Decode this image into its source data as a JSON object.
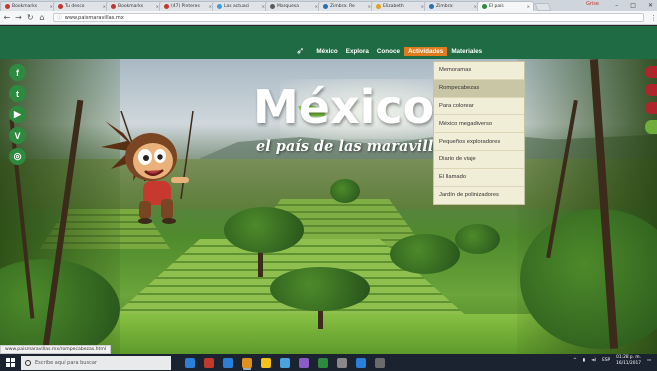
{
  "browser": {
    "tabs": [
      {
        "label": "Bookmarks",
        "color": "#c0392b"
      },
      {
        "label": "Tu desco",
        "color": "#c0392b"
      },
      {
        "label": "Bookmarks",
        "color": "#c0392b"
      },
      {
        "label": "(47) Pinteres",
        "color": "#c0392b"
      },
      {
        "label": "Las actuaci",
        "color": "#3aa0d8"
      },
      {
        "label": "Marquesa",
        "color": "#5b5b5b"
      },
      {
        "label": "Zimbra: Re",
        "color": "#2c6fb0"
      },
      {
        "label": "Elizabeth",
        "color": "#e0a020"
      },
      {
        "label": "Zimbra:",
        "color": "#2c6fb0"
      },
      {
        "label": "El país",
        "color": "#2e8a3e"
      }
    ],
    "profile": "Grise",
    "window_controls": [
      "–",
      "□",
      "✕"
    ],
    "url": "www.paismaravillas.mx"
  },
  "site": {
    "nav": {
      "items": [
        {
          "label": "México",
          "active": false
        },
        {
          "label": "Explora",
          "active": false
        },
        {
          "label": "Conoce",
          "active": false
        },
        {
          "label": "Actividades",
          "active": true
        },
        {
          "label": "Materiales",
          "active": false
        }
      ]
    },
    "title": "México",
    "subtitle": "el país de las maravillas",
    "dropdown": {
      "items": [
        {
          "label": "Memoramas",
          "hover": false
        },
        {
          "label": "Rompecabezas",
          "hover": true
        },
        {
          "label": "Para colorear",
          "hover": false
        },
        {
          "label": "México megadiverso",
          "hover": false
        },
        {
          "label": "Pequeños exploradores",
          "hover": false
        },
        {
          "label": "Diario de viaje",
          "hover": false
        },
        {
          "label": "El llamado",
          "hover": false
        },
        {
          "label": "Jardín de polinizadores",
          "hover": false
        }
      ]
    },
    "social": [
      {
        "icon": "facebook-icon",
        "glyph": "f"
      },
      {
        "icon": "twitter-icon",
        "glyph": "t"
      },
      {
        "icon": "youtube-icon",
        "glyph": "▶"
      },
      {
        "icon": "vimeo-icon",
        "glyph": "V"
      },
      {
        "icon": "instagram-icon",
        "glyph": "◎"
      }
    ],
    "status_url": "www.paismaravillas.mx/rompecabezas.html"
  },
  "taskbar": {
    "search_placeholder": "Escribe aquí para buscar",
    "apps": [
      "#2b7fd8",
      "#c0392b",
      "#2b7fd8",
      "#e09020",
      "#f2c318",
      "#4aa3df",
      "#8a5cc6",
      "#2e8a3e",
      "#888888",
      "#2b7fd8",
      "#6b6b6b"
    ],
    "tray_lang": "ESP",
    "time": "01:28 p. m.",
    "date": "16/11/2017"
  },
  "colors": {
    "nav_bg": "#1f6b43",
    "nav_active": "#e07b1e",
    "dropdown_bg": "#f1eed8"
  }
}
